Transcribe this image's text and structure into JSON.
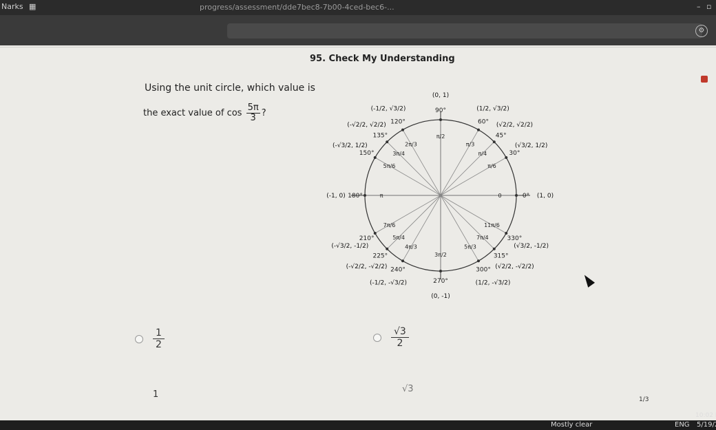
{
  "window": {
    "app_label": "Narks",
    "url_text": "progress/assessment/dde7bec8-7b00-4ced-bec6-..."
  },
  "question": {
    "title": "95. Check My Understanding",
    "prompt_line1": "Using the unit circle, which value is",
    "prompt_line2_prefix": "the exact value of cos",
    "angle_num": "5π",
    "angle_den": "3",
    "prompt_suffix": "?"
  },
  "choices": [
    {
      "num": "1",
      "den": "2"
    },
    {
      "num": "√3",
      "den": "2"
    },
    {
      "num": "1",
      "den": ""
    },
    {
      "num": "√3",
      "den": ""
    }
  ],
  "pager": {
    "text": "1/3"
  },
  "taskbar": {
    "weather": "Mostly clear",
    "lang": "ENG",
    "time": "10:02 P",
    "date": "5/19/2"
  },
  "unit_circle": {
    "degrees": [
      "0°",
      "30°",
      "45°",
      "60°",
      "90°",
      "120°",
      "135°",
      "150°",
      "180°",
      "210°",
      "225°",
      "240°",
      "270°",
      "300°",
      "315°",
      "330°"
    ],
    "radians": [
      "0",
      "π/6",
      "π/4",
      "π/3",
      "π/2",
      "2π/3",
      "3π/4",
      "5π/6",
      "π",
      "7π/6",
      "5π/4",
      "4π/3",
      "3π/2",
      "5π/3",
      "7π/4",
      "11π/6"
    ],
    "points": [
      "(1, 0)",
      "(√3/2, 1/2)",
      "(√2/2, √2/2)",
      "(1/2, √3/2)",
      "(0, 1)",
      "(-1/2, √3/2)",
      "(-√2/2, √2/2)",
      "(-√3/2, 1/2)",
      "(-1, 0)",
      "(-√3/2, -1/2)",
      "(-√2/2, -√2/2)",
      "(-1/2, -√3/2)",
      "(0, -1)",
      "(1/2, -√3/2)",
      "(√2/2, -√2/2)",
      "(√3/2, -1/2)"
    ]
  }
}
